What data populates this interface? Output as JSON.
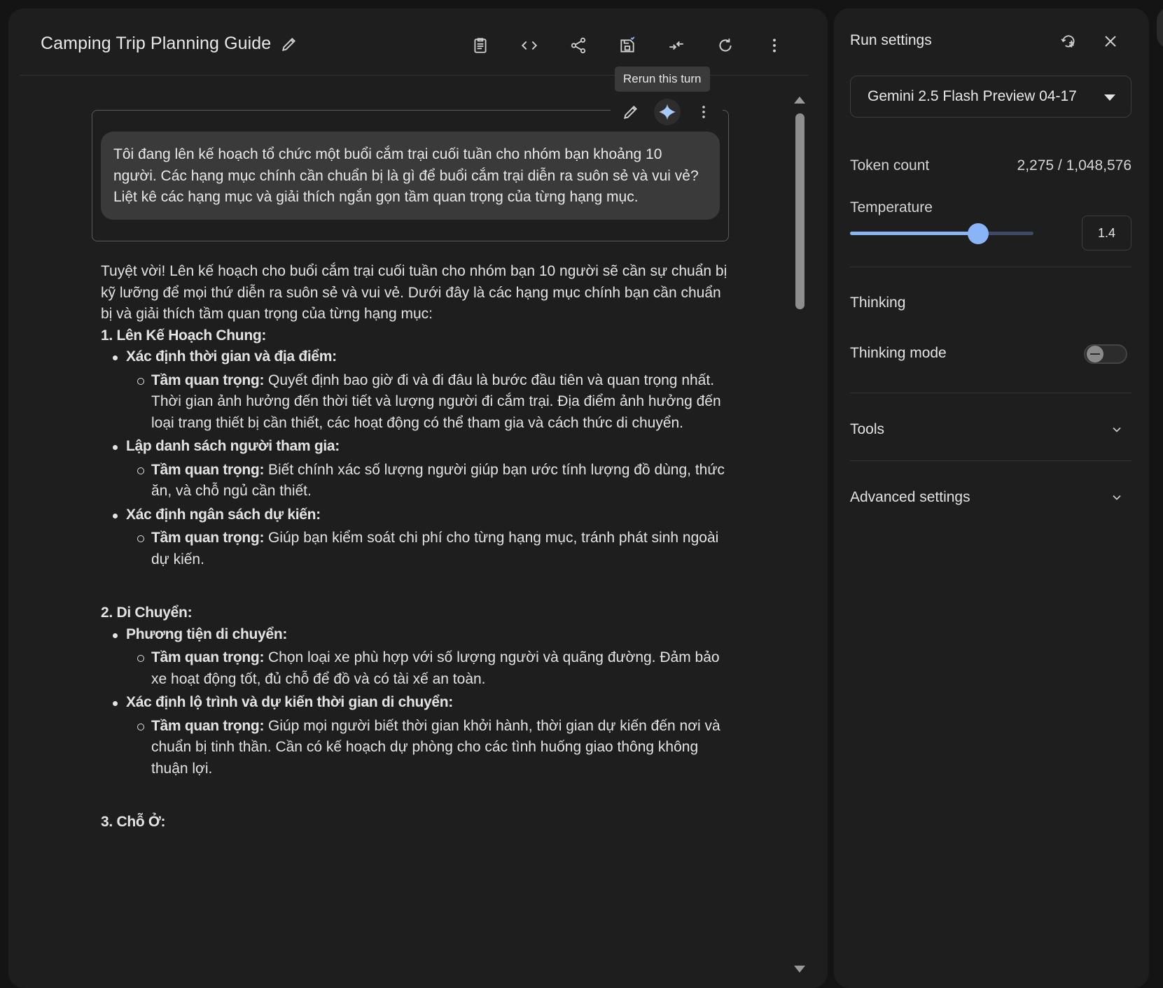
{
  "header": {
    "title": "Camping Trip Planning Guide",
    "icons": [
      "edit-icon",
      "clipboard-icon",
      "code-icon",
      "share-icon",
      "save-icon",
      "compare-icon",
      "refresh-icon",
      "more-vert-icon"
    ]
  },
  "tooltip": {
    "text": "Rerun this turn"
  },
  "user_turn": {
    "text": "Tôi đang lên kế hoạch tổ chức một buổi cắm trại cuối tuần cho nhóm bạn khoảng 10 người. Các hạng mục chính cần chuẩn bị là gì để buổi cắm trại diễn ra suôn sẻ và vui vẻ? Liệt kê các hạng mục và giải thích ngắn gọn tầm quan trọng của từng hạng mục."
  },
  "response": {
    "intro": "Tuyệt vời! Lên kế hoạch cho buổi cắm trại cuối tuần cho nhóm bạn 10 người sẽ cần sự chuẩn bị kỹ lưỡng để mọi thứ diễn ra suôn sẻ và vui vẻ. Dưới đây là các hạng mục chính bạn cần chuẩn bị và giải thích tầm quan trọng của từng hạng mục:",
    "importance_label": "Tầm quan trọng:",
    "sections": [
      {
        "heading": "1. Lên Kế Hoạch Chung:",
        "items": [
          {
            "title": "Xác định thời gian và địa điểm:",
            "detail": "Quyết định bao giờ đi và đi đâu là bước đầu tiên và quan trọng nhất. Thời gian ảnh hưởng đến thời tiết và lượng người đi cắm trại. Địa điểm ảnh hưởng đến loại trang thiết bị cần thiết, các hoạt động có thể tham gia và cách thức di chuyển."
          },
          {
            "title": "Lập danh sách người tham gia:",
            "detail": "Biết chính xác số lượng người giúp bạn ước tính lượng đồ dùng, thức ăn, và chỗ ngủ cần thiết."
          },
          {
            "title": "Xác định ngân sách dự kiến:",
            "detail": "Giúp bạn kiểm soát chi phí cho từng hạng mục, tránh phát sinh ngoài dự kiến."
          }
        ]
      },
      {
        "heading": "2. Di Chuyển:",
        "items": [
          {
            "title": "Phương tiện di chuyển:",
            "detail": "Chọn loại xe phù hợp với số lượng người và quãng đường. Đảm bảo xe hoạt động tốt, đủ chỗ để đồ và có tài xế an toàn."
          },
          {
            "title": "Xác định lộ trình và dự kiến thời gian di chuyển:",
            "detail": "Giúp mọi người biết thời gian khởi hành, thời gian dự kiến đến nơi và chuẩn bị tinh thần. Cần có kế hoạch dự phòng cho các tình huống giao thông không thuận lợi."
          }
        ]
      },
      {
        "heading": "3. Chỗ Ở:",
        "items": []
      }
    ]
  },
  "run_settings": {
    "title": "Run settings",
    "model": "Gemini 2.5 Flash Preview 04-17",
    "token_count_label": "Token count",
    "token_count_value": "2,275 / 1,048,576",
    "temperature_label": "Temperature",
    "temperature_value": "1.4",
    "temperature_fraction": 0.7,
    "thinking_heading": "Thinking",
    "thinking_mode_label": "Thinking mode",
    "thinking_mode_on": false,
    "tools_label": "Tools",
    "advanced_label": "Advanced settings"
  },
  "colors": {
    "background": "#1e1e1e",
    "accent": "#8ab4f8",
    "bubble": "#3a3a3a"
  }
}
